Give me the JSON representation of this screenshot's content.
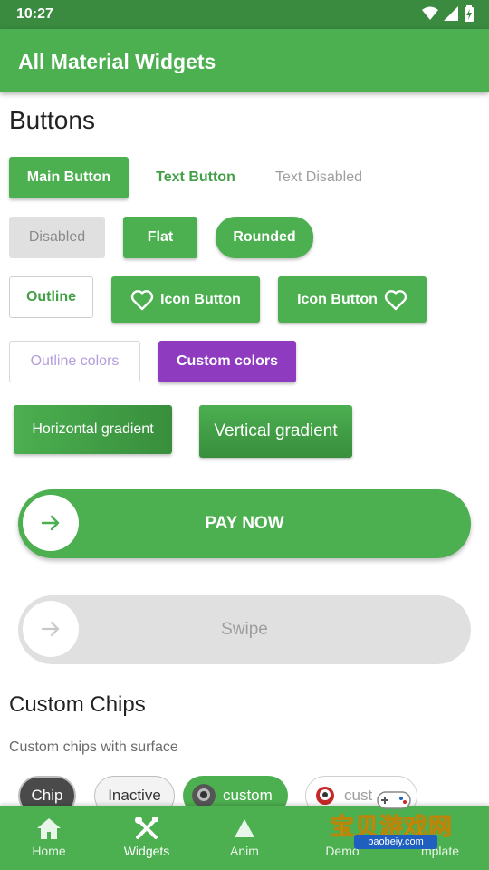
{
  "status_bar": {
    "time": "10:27",
    "icons": [
      "wifi-icon",
      "signal-icon",
      "battery-icon"
    ]
  },
  "app_bar": {
    "title": "All Material Widgets"
  },
  "buttons_section": {
    "title": "Buttons",
    "main_button": "Main Button",
    "text_button": "Text Button",
    "text_disabled": "Text Disabled",
    "disabled": "Disabled",
    "flat": "Flat",
    "rounded": "Rounded",
    "outline": "Outline",
    "icon_button_left": "Icon Button",
    "icon_button_right": "Icon Button",
    "outline_colors": "Outline colors",
    "custom_colors": "Custom colors",
    "horizontal_gradient": "Horizontal gradient",
    "vertical_gradient": "Vertical gradient",
    "pay_now": "PAY NOW",
    "swipe": "Swipe"
  },
  "chips_section": {
    "title": "Custom Chips",
    "subtitle": "Custom chips with surface",
    "chips": [
      "Chip",
      "Inactive",
      "custom",
      "cust"
    ]
  },
  "bottom_nav": {
    "items": [
      {
        "label": "Home",
        "icon": "home-icon"
      },
      {
        "label": "Widgets",
        "icon": "tools-icon"
      },
      {
        "label": "Anim",
        "icon": "triangle-icon"
      },
      {
        "label": "Demo",
        "icon": ""
      },
      {
        "label": "mplate",
        "icon": ""
      }
    ],
    "active": "Widgets"
  },
  "watermark": {
    "text": "宝贝游戏网",
    "url": "baobeiy.com"
  },
  "colors": {
    "primary": "#4caf50",
    "primary_dark": "#3a8a3f",
    "accent_purple": "#8e3bbf",
    "outline_purple_text": "#b39ddb",
    "disabled_bg": "#e0e0e0"
  }
}
